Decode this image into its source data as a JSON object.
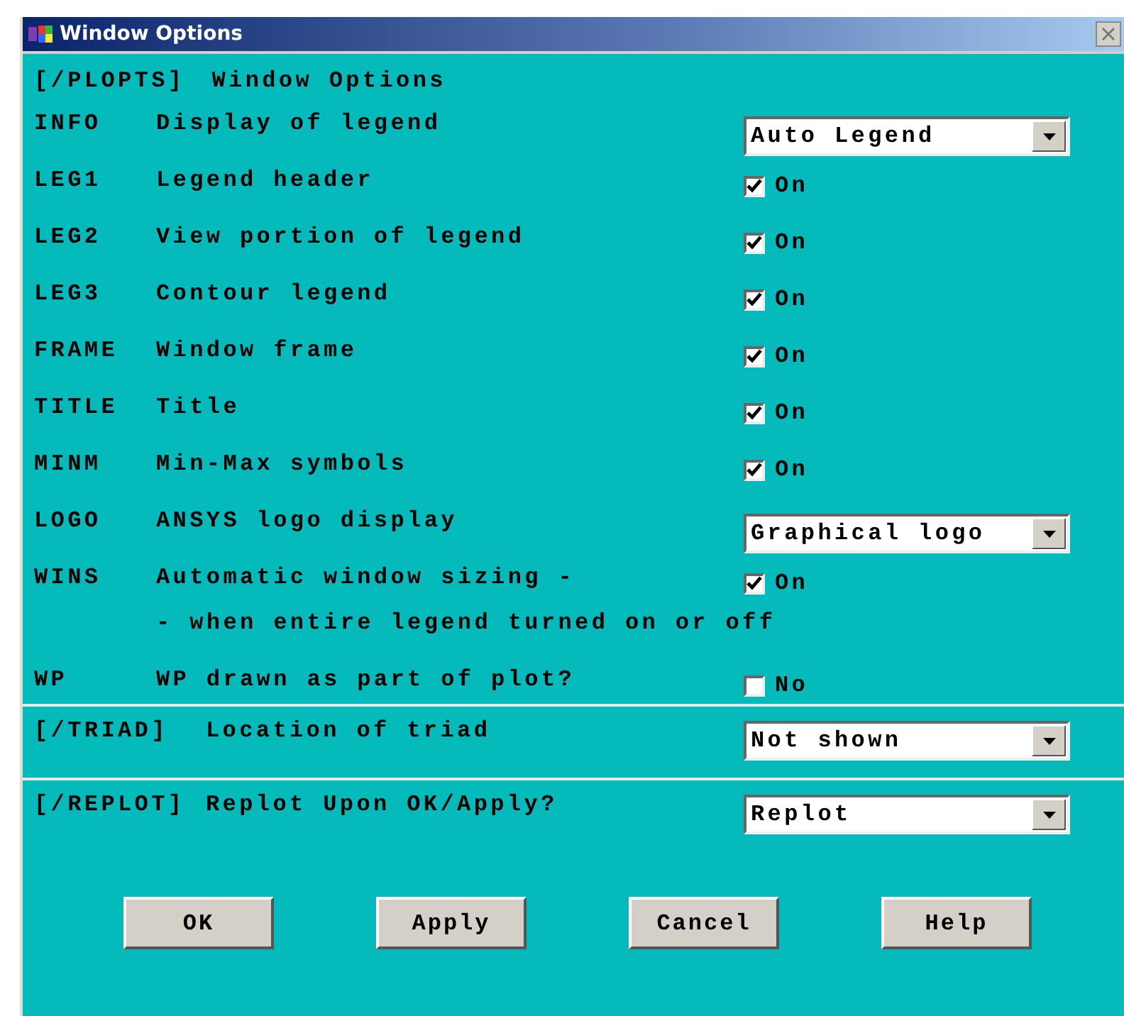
{
  "window": {
    "title": "Window Options"
  },
  "header": {
    "command": "[/PLOPTS]",
    "title": "Window Options"
  },
  "rows": [
    {
      "kind": "dropdown",
      "code": "INFO",
      "label": "Display of legend",
      "value": "Auto Legend"
    },
    {
      "kind": "checkbox",
      "code": "LEG1",
      "label": "Legend header",
      "checked": true,
      "text": "On"
    },
    {
      "kind": "checkbox",
      "code": "LEG2",
      "label": "View portion of legend",
      "checked": true,
      "text": "On"
    },
    {
      "kind": "checkbox",
      "code": "LEG3",
      "label": "Contour legend",
      "checked": true,
      "text": "On"
    },
    {
      "kind": "checkbox",
      "code": "FRAME",
      "label": "Window frame",
      "checked": true,
      "text": "On"
    },
    {
      "kind": "checkbox",
      "code": "TITLE",
      "label": "Title",
      "checked": true,
      "text": "On"
    },
    {
      "kind": "checkbox",
      "code": "MINM",
      "label": "Min-Max symbols",
      "checked": true,
      "text": "On"
    },
    {
      "kind": "dropdown",
      "code": "LOGO",
      "label": "ANSYS logo display",
      "value": "Graphical logo"
    },
    {
      "kind": "checkbox",
      "code": "WINS",
      "label": "Automatic window sizing -",
      "checked": true,
      "text": "On"
    },
    {
      "kind": "note",
      "label": "- when entire legend turned on or off"
    },
    {
      "kind": "checkbox",
      "code": "WP",
      "label": "WP drawn as part of plot?",
      "checked": false,
      "text": "No"
    }
  ],
  "sections": [
    {
      "command": "[/TRIAD]",
      "label": "Location of triad",
      "value": "Not shown"
    },
    {
      "command": "[/REPLOT]",
      "label": "Replot Upon OK/Apply?",
      "value": "Replot"
    }
  ],
  "buttons": [
    "OK",
    "Apply",
    "Cancel",
    "Help"
  ]
}
